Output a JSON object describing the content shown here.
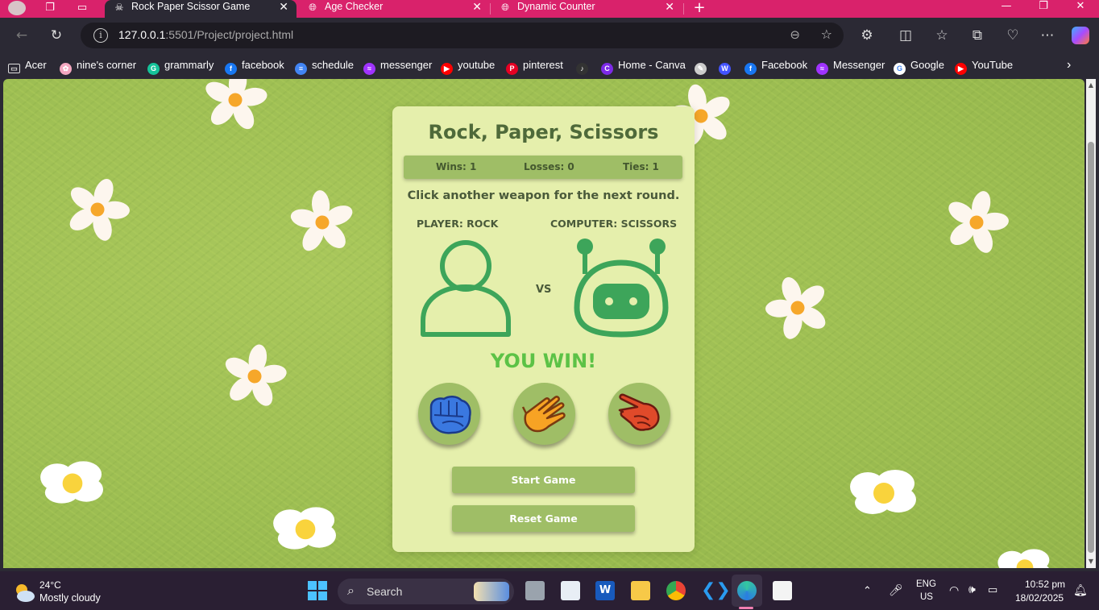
{
  "browser": {
    "tabs": [
      {
        "title": "Rock Paper Scissor Game",
        "active": true
      },
      {
        "title": "Age Checker",
        "active": false
      },
      {
        "title": "Dynamic Counter",
        "active": false
      }
    ],
    "url_host": "127.0.0.1",
    "url_rest": ":5501/Project/project.html",
    "bookmarks": [
      {
        "label": "Acer",
        "icon": "folder-icon",
        "color": "#cccccc"
      },
      {
        "label": "nine's corner",
        "icon": "flower-icon",
        "color": "#f4a7c0"
      },
      {
        "label": "grammarly",
        "icon": "grammarly-icon",
        "color": "#15c39a"
      },
      {
        "label": "facebook",
        "icon": "facebook-icon",
        "color": "#1877f2"
      },
      {
        "label": "schedule",
        "icon": "docs-icon",
        "color": "#4285f4"
      },
      {
        "label": "messenger",
        "icon": "messenger-icon",
        "color": "#a033ff"
      },
      {
        "label": "youtube",
        "icon": "youtube-icon",
        "color": "#ff0000"
      },
      {
        "label": "pinterest",
        "icon": "pinterest-icon",
        "color": "#e60023"
      },
      {
        "label": "",
        "icon": "mp3-icon",
        "color": "#333333"
      },
      {
        "label": "Home - Canva",
        "icon": "canva-icon",
        "color": "#7d2ae8"
      },
      {
        "label": "",
        "icon": "pen-icon",
        "color": "#cccccc"
      },
      {
        "label": "",
        "icon": "webflow-icon",
        "color": "#4353ff"
      },
      {
        "label": "Facebook",
        "icon": "facebook-icon",
        "color": "#1877f2"
      },
      {
        "label": "Messenger",
        "icon": "messenger-icon",
        "color": "#a033ff"
      },
      {
        "label": "Google",
        "icon": "google-icon",
        "color": "#ffffff"
      },
      {
        "label": "YouTube",
        "icon": "youtube-icon",
        "color": "#ff0000"
      }
    ]
  },
  "game": {
    "title": "Rock, Paper, Scissors",
    "wins": "Wins: 1",
    "losses": "Losses: 0",
    "ties": "Ties: 1",
    "message": "Click another weapon for the next round.",
    "player_label": "PLAYER: ROCK",
    "computer_label": "COMPUTER: SCISSORS",
    "vs": "VS",
    "result": "YOU WIN!",
    "weapons": [
      "rock",
      "paper",
      "scissors"
    ],
    "start_label": "Start Game",
    "reset_label": "Reset Game",
    "colors": {
      "accent": "#5cc246",
      "card": "#e5efac",
      "button": "#9fbe66",
      "icon_green": "#3da55a"
    }
  },
  "taskbar": {
    "temperature": "24°C",
    "weather": "Mostly cloudy",
    "search_label": "Search",
    "lang": "ENG",
    "region": "US",
    "time": "10:52 pm",
    "date": "18/02/2025"
  }
}
